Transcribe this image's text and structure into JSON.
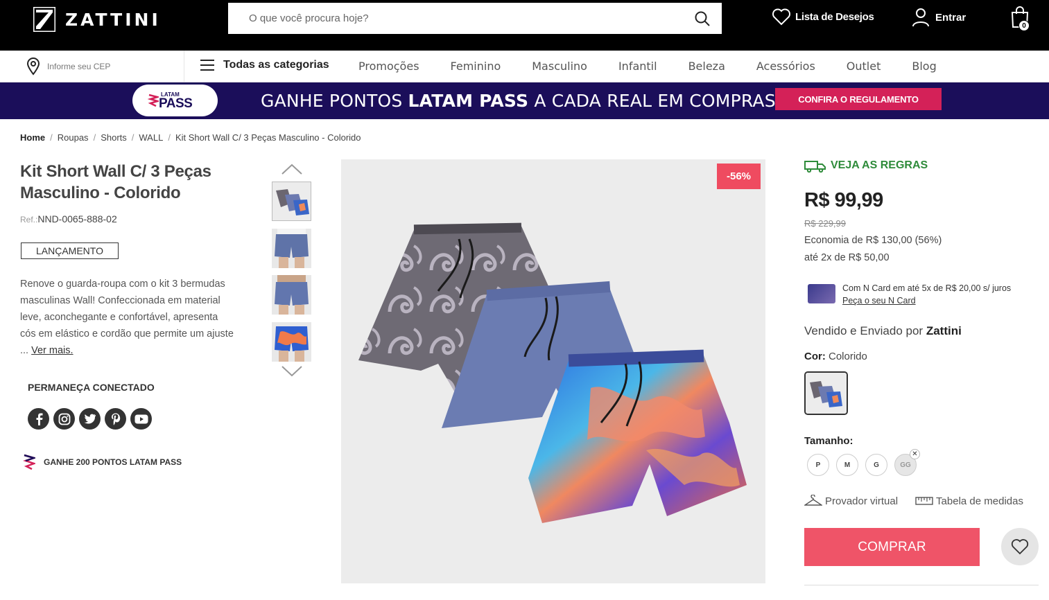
{
  "header": {
    "brand": "ZATTINI",
    "search_placeholder": "O que você procura hoje?",
    "wishlist_label": "Lista de Desejos",
    "login_label": "Entrar",
    "cart_count": "0"
  },
  "nav": {
    "cep_placeholder": "Informe seu CEP",
    "all_categories": "Todas as categorias",
    "links": [
      "Promoções",
      "Feminino",
      "Masculino",
      "Infantil",
      "Beleza",
      "Acessórios",
      "Outlet",
      "Blog"
    ]
  },
  "banner": {
    "badge_small": "LATAM",
    "badge_main": "PASS",
    "text_part1": "GANHE PONTOS ",
    "text_bold": "LATAM PASS",
    "text_part2": " A CADA REAL EM COMPRAS",
    "button": "CONFIRA O REGULAMENTO"
  },
  "breadcrumb": [
    "Home",
    "Roupas",
    "Shorts",
    "WALL",
    "Kit Short Wall C/ 3 Peças Masculino - Colorido"
  ],
  "product": {
    "title": "Kit Short Wall C/ 3 Peças Masculino - Colorido",
    "ref_label": "Ref.:",
    "ref": "NND-0065-888-02",
    "tag": "LANÇAMENTO",
    "description": "Renove o guarda-roupa com o kit 3 bermudas masculinas Wall! Confeccionada em material leve, aconchegante e confortável, apresenta cós em elástico e cordão que permite um ajuste ... ",
    "see_more": "Ver mais.",
    "discount": "-56%"
  },
  "social": {
    "title": "PERMANEÇA CONECTADO",
    "icons": [
      "f",
      "ig",
      "tw",
      "p",
      "yt"
    ]
  },
  "points_text": "GANHE 200 PONTOS LATAM PASS",
  "buy_box": {
    "shipping_rules": "VEJA AS REGRAS",
    "price": "R$ 99,99",
    "old_price": "R$ 229,99",
    "economy": "Economia de R$ 130,00 (56%)",
    "installments": "até 2x de R$ 50,00",
    "ncard_text": "Com N Card em até 5x de R$ 20,00 s/ juros",
    "ncard_link": "Peça o seu N Card",
    "sold_prefix": "Vendido e Enviado por ",
    "seller": "Zattini",
    "color_label": "Cor:",
    "color_value": " Colorido",
    "size_label": "Tamanho:",
    "sizes": [
      "P",
      "M",
      "G",
      "GG"
    ],
    "virtual_fitting": "Provador virtual",
    "size_chart": "Tabela de medidas",
    "buy_label": "COMPRAR"
  },
  "colors": {
    "accent": "#ef5468",
    "badge": "#ef4b60",
    "banner_bg": "#1b0e5a",
    "banner_btn": "#d42158",
    "shipping_green": "#2e8b3a"
  }
}
